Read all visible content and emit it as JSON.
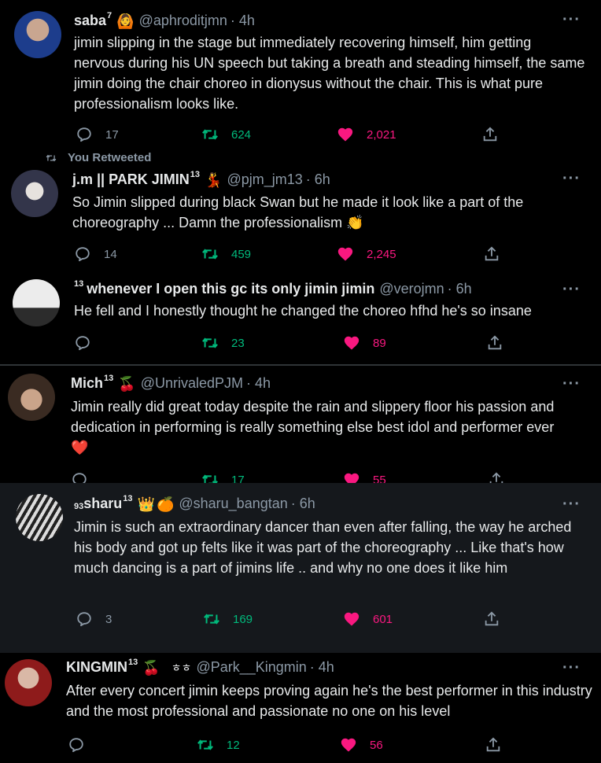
{
  "tweets": [
    {
      "retweet_label": "",
      "name": "saba",
      "name_sup": "7",
      "emoji": "🙆",
      "emoji2": "",
      "handle": "@aphroditjmn",
      "time": "· 4h",
      "text": "jimin slipping in the stage but immediately recovering himself, him getting nervous during his UN speech but taking a breath and steading himself, the same jimin doing the chair choreo in dionysus without the chair. This is what pure professionalism looks like.",
      "replies": "17",
      "retweets": "624",
      "likes": "2,021"
    },
    {
      "retweet_label": "You Retweeted",
      "name": "j.m || PARK JIMIN",
      "name_sup": "13",
      "emoji": "💃",
      "emoji2": "",
      "handle": "@pjm_jm13",
      "time": "· 6h",
      "text": "So Jimin slipped during black Swan but he made it look like a part of the choreography ... Damn the professionalism 👏",
      "replies": "14",
      "retweets": "459",
      "likes": "2,245"
    },
    {
      "retweet_label": "",
      "name": "whenever I open this gc its only jimin jimin",
      "name_pre": "13",
      "emoji": "",
      "emoji2": "",
      "handle": "@verojmn",
      "time": "· 6h",
      "text": "He fell and I honestly thought he changed the choreo hfhd he's so insane",
      "replies": "",
      "retweets": "23",
      "likes": "89"
    },
    {
      "retweet_label": "",
      "name": "Mich",
      "name_sup": "13",
      "emoji": "🍒",
      "emoji2": "",
      "handle": "@UnrivaledPJM",
      "time": "· 4h",
      "text": "Jimin really did great today despite the rain and slippery floor his passion and dedication in performing is really something else best idol and performer ever ❤️",
      "replies": "",
      "retweets": "17",
      "likes": "55"
    },
    {
      "retweet_label": "",
      "name": "sharu",
      "name_pre": "93",
      "name_sup": "13",
      "emoji": "👑",
      "emoji2": "🍊",
      "handle": "@sharu_bangtan",
      "time": "· 6h",
      "text": "Jimin is such an extraordinary dancer than even after falling, the way he arched his body and got up felts like it was part of the choreography ... Like that's how much dancing is a part of jimins life .. and why no one does it like him",
      "replies": "3",
      "retweets": "169",
      "likes": "601"
    },
    {
      "retweet_label": "",
      "name": "KINGMIN",
      "name_sup": "13",
      "emoji": "🍒",
      "emoji2": "ㅎㅎ",
      "handle": "@Park__Kingmin",
      "time": "· 4h",
      "text": "After every concert jimin keeps proving again he's the best performer in this industry and the most professional and passionate no one on his level",
      "replies": "",
      "retweets": "12",
      "likes": "56"
    }
  ],
  "more_label": "···",
  "icons": [
    "reply-icon",
    "retweet-icon",
    "like-icon",
    "share-icon",
    "more-icon"
  ],
  "colors": {
    "background": "#000000",
    "retweet": "#00ba7c",
    "like": "#f91880",
    "muted": "#8b98a5"
  }
}
